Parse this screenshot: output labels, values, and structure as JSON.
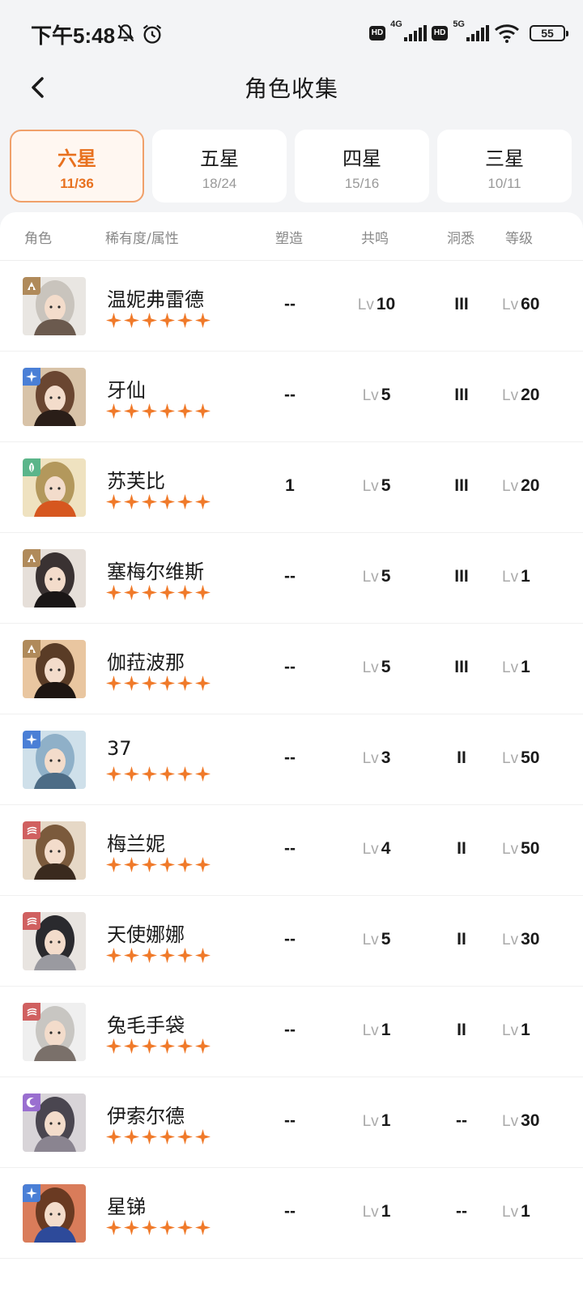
{
  "status_bar": {
    "time": "下午5:48",
    "network_1": "4G",
    "network_2": "5G",
    "hd": "HD",
    "battery": "55"
  },
  "header": {
    "title": "角色收集"
  },
  "tabs": [
    {
      "label": "六星",
      "count": "11/36",
      "active": true
    },
    {
      "label": "五星",
      "count": "18/24",
      "active": false
    },
    {
      "label": "四星",
      "count": "15/16",
      "active": false
    },
    {
      "label": "三星",
      "count": "10/11",
      "active": false
    }
  ],
  "table": {
    "headers": {
      "role": "角色",
      "rarity": "稀有度/属性",
      "remold": "塑造",
      "resonance": "共鸣",
      "insight": "洞悉",
      "level": "等级"
    },
    "lv_prefix": "Lv",
    "star_count": 6,
    "colors": {
      "accent": "#e8711f",
      "star": "#f07a2a",
      "attr_brown": "#b08a5a",
      "attr_blue": "#4a7fd6",
      "attr_green": "#5bb58a",
      "attr_red": "#d06060",
      "attr_purple": "#9a6fd0"
    },
    "rows": [
      {
        "name": "温妮弗雷德",
        "attr": "brown",
        "remold": "--",
        "resonance": "10",
        "insight": "III",
        "level": "60"
      },
      {
        "name": "牙仙",
        "attr": "blue",
        "remold": "--",
        "resonance": "5",
        "insight": "III",
        "level": "20"
      },
      {
        "name": "苏芙比",
        "attr": "green",
        "remold": "1",
        "resonance": "5",
        "insight": "III",
        "level": "20"
      },
      {
        "name": "塞梅尔维斯",
        "attr": "brown",
        "remold": "--",
        "resonance": "5",
        "insight": "III",
        "level": "1"
      },
      {
        "name": "伽菈波那",
        "attr": "brown",
        "remold": "--",
        "resonance": "5",
        "insight": "III",
        "level": "1"
      },
      {
        "name": "37",
        "attr": "blue",
        "remold": "--",
        "resonance": "3",
        "insight": "II",
        "level": "50"
      },
      {
        "name": "梅兰妮",
        "attr": "red",
        "remold": "--",
        "resonance": "4",
        "insight": "II",
        "level": "50"
      },
      {
        "name": "天使娜娜",
        "attr": "red",
        "remold": "--",
        "resonance": "5",
        "insight": "II",
        "level": "30"
      },
      {
        "name": "兔毛手袋",
        "attr": "red",
        "remold": "--",
        "resonance": "1",
        "insight": "II",
        "level": "1"
      },
      {
        "name": "伊索尔德",
        "attr": "purple",
        "remold": "--",
        "resonance": "1",
        "insight": "--",
        "level": "30"
      },
      {
        "name": "星锑",
        "attr": "blue",
        "remold": "--",
        "resonance": "1",
        "insight": "--",
        "level": "1"
      }
    ]
  }
}
